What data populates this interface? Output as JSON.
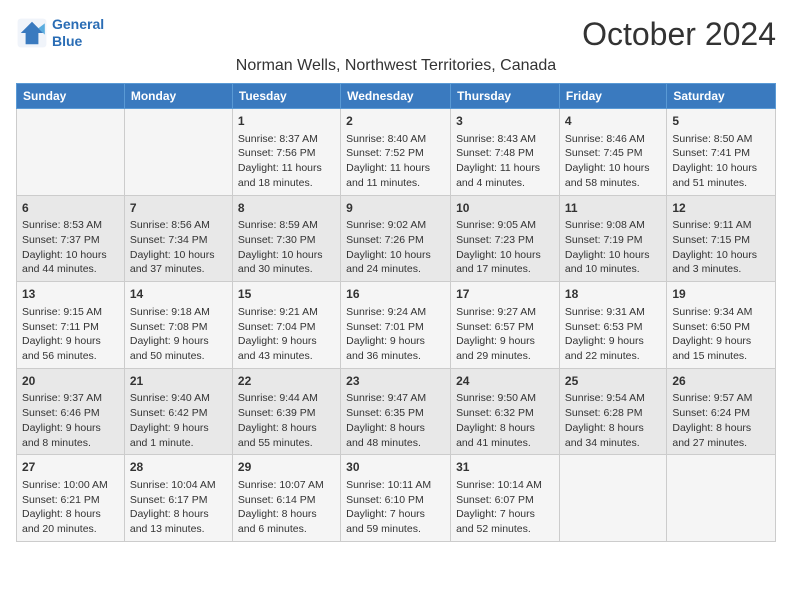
{
  "logo": {
    "line1": "General",
    "line2": "Blue"
  },
  "title": "October 2024",
  "subtitle": "Norman Wells, Northwest Territories, Canada",
  "days_of_week": [
    "Sunday",
    "Monday",
    "Tuesday",
    "Wednesday",
    "Thursday",
    "Friday",
    "Saturday"
  ],
  "weeks": [
    [
      {
        "day": "",
        "text": ""
      },
      {
        "day": "",
        "text": ""
      },
      {
        "day": "1",
        "text": "Sunrise: 8:37 AM\nSunset: 7:56 PM\nDaylight: 11 hours and 18 minutes."
      },
      {
        "day": "2",
        "text": "Sunrise: 8:40 AM\nSunset: 7:52 PM\nDaylight: 11 hours and 11 minutes."
      },
      {
        "day": "3",
        "text": "Sunrise: 8:43 AM\nSunset: 7:48 PM\nDaylight: 11 hours and 4 minutes."
      },
      {
        "day": "4",
        "text": "Sunrise: 8:46 AM\nSunset: 7:45 PM\nDaylight: 10 hours and 58 minutes."
      },
      {
        "day": "5",
        "text": "Sunrise: 8:50 AM\nSunset: 7:41 PM\nDaylight: 10 hours and 51 minutes."
      }
    ],
    [
      {
        "day": "6",
        "text": "Sunrise: 8:53 AM\nSunset: 7:37 PM\nDaylight: 10 hours and 44 minutes."
      },
      {
        "day": "7",
        "text": "Sunrise: 8:56 AM\nSunset: 7:34 PM\nDaylight: 10 hours and 37 minutes."
      },
      {
        "day": "8",
        "text": "Sunrise: 8:59 AM\nSunset: 7:30 PM\nDaylight: 10 hours and 30 minutes."
      },
      {
        "day": "9",
        "text": "Sunrise: 9:02 AM\nSunset: 7:26 PM\nDaylight: 10 hours and 24 minutes."
      },
      {
        "day": "10",
        "text": "Sunrise: 9:05 AM\nSunset: 7:23 PM\nDaylight: 10 hours and 17 minutes."
      },
      {
        "day": "11",
        "text": "Sunrise: 9:08 AM\nSunset: 7:19 PM\nDaylight: 10 hours and 10 minutes."
      },
      {
        "day": "12",
        "text": "Sunrise: 9:11 AM\nSunset: 7:15 PM\nDaylight: 10 hours and 3 minutes."
      }
    ],
    [
      {
        "day": "13",
        "text": "Sunrise: 9:15 AM\nSunset: 7:11 PM\nDaylight: 9 hours and 56 minutes."
      },
      {
        "day": "14",
        "text": "Sunrise: 9:18 AM\nSunset: 7:08 PM\nDaylight: 9 hours and 50 minutes."
      },
      {
        "day": "15",
        "text": "Sunrise: 9:21 AM\nSunset: 7:04 PM\nDaylight: 9 hours and 43 minutes."
      },
      {
        "day": "16",
        "text": "Sunrise: 9:24 AM\nSunset: 7:01 PM\nDaylight: 9 hours and 36 minutes."
      },
      {
        "day": "17",
        "text": "Sunrise: 9:27 AM\nSunset: 6:57 PM\nDaylight: 9 hours and 29 minutes."
      },
      {
        "day": "18",
        "text": "Sunrise: 9:31 AM\nSunset: 6:53 PM\nDaylight: 9 hours and 22 minutes."
      },
      {
        "day": "19",
        "text": "Sunrise: 9:34 AM\nSunset: 6:50 PM\nDaylight: 9 hours and 15 minutes."
      }
    ],
    [
      {
        "day": "20",
        "text": "Sunrise: 9:37 AM\nSunset: 6:46 PM\nDaylight: 9 hours and 8 minutes."
      },
      {
        "day": "21",
        "text": "Sunrise: 9:40 AM\nSunset: 6:42 PM\nDaylight: 9 hours and 1 minute."
      },
      {
        "day": "22",
        "text": "Sunrise: 9:44 AM\nSunset: 6:39 PM\nDaylight: 8 hours and 55 minutes."
      },
      {
        "day": "23",
        "text": "Sunrise: 9:47 AM\nSunset: 6:35 PM\nDaylight: 8 hours and 48 minutes."
      },
      {
        "day": "24",
        "text": "Sunrise: 9:50 AM\nSunset: 6:32 PM\nDaylight: 8 hours and 41 minutes."
      },
      {
        "day": "25",
        "text": "Sunrise: 9:54 AM\nSunset: 6:28 PM\nDaylight: 8 hours and 34 minutes."
      },
      {
        "day": "26",
        "text": "Sunrise: 9:57 AM\nSunset: 6:24 PM\nDaylight: 8 hours and 27 minutes."
      }
    ],
    [
      {
        "day": "27",
        "text": "Sunrise: 10:00 AM\nSunset: 6:21 PM\nDaylight: 8 hours and 20 minutes."
      },
      {
        "day": "28",
        "text": "Sunrise: 10:04 AM\nSunset: 6:17 PM\nDaylight: 8 hours and 13 minutes."
      },
      {
        "day": "29",
        "text": "Sunrise: 10:07 AM\nSunset: 6:14 PM\nDaylight: 8 hours and 6 minutes."
      },
      {
        "day": "30",
        "text": "Sunrise: 10:11 AM\nSunset: 6:10 PM\nDaylight: 7 hours and 59 minutes."
      },
      {
        "day": "31",
        "text": "Sunrise: 10:14 AM\nSunset: 6:07 PM\nDaylight: 7 hours and 52 minutes."
      },
      {
        "day": "",
        "text": ""
      },
      {
        "day": "",
        "text": ""
      }
    ]
  ]
}
